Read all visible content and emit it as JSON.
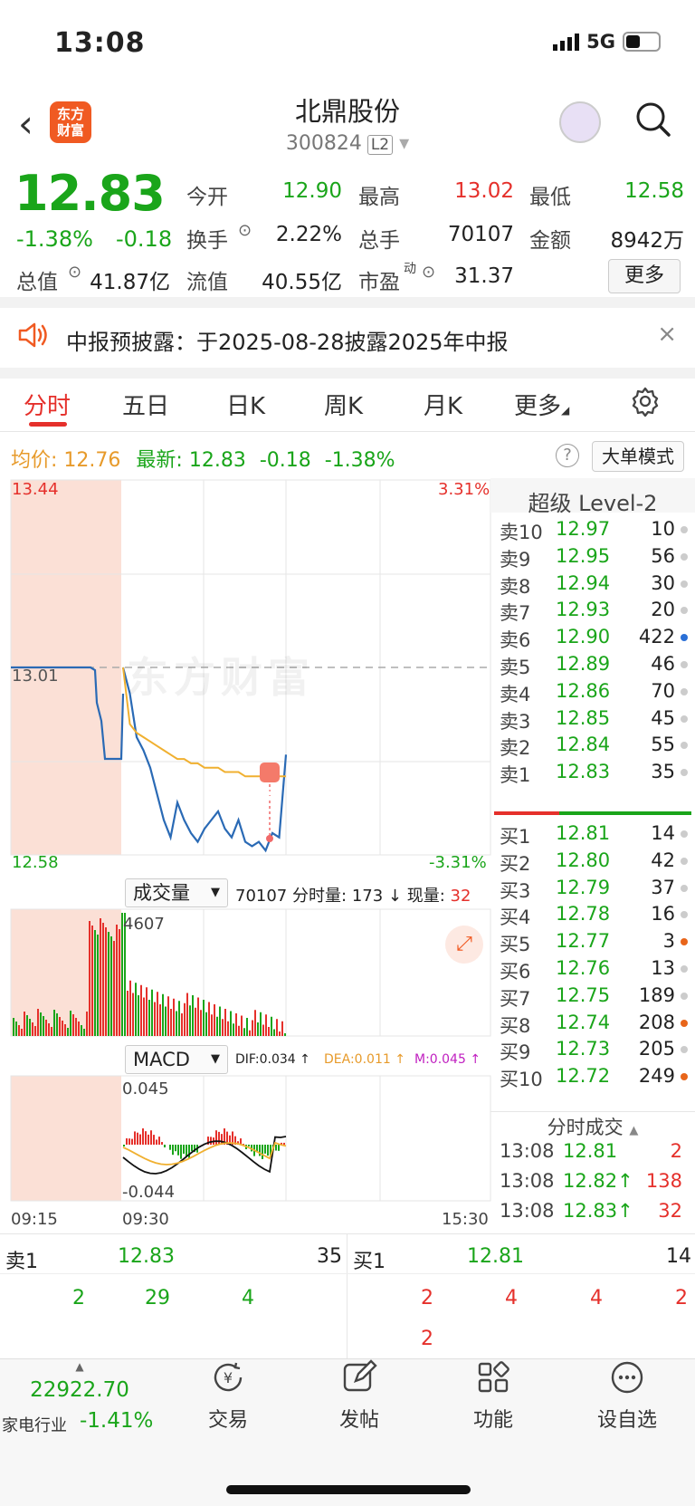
{
  "status": {
    "time": "13:08",
    "network": "5G"
  },
  "header": {
    "logo_text": "东方\n财富",
    "title": "北鼎股份",
    "code": "300824",
    "level": "L2"
  },
  "quote": {
    "price": "12.83",
    "change_pct": "-1.38%",
    "change": "-0.18",
    "fields": [
      {
        "label": "今开",
        "value": "12.90",
        "color": "green"
      },
      {
        "label": "最高",
        "value": "13.02",
        "color": "red"
      },
      {
        "label": "最低",
        "value": "12.58",
        "color": "green"
      },
      {
        "label": "换手",
        "value": "2.22%",
        "color": "dark"
      },
      {
        "label": "总手",
        "value": "70107",
        "color": "dark"
      },
      {
        "label": "金额",
        "value": "8942万",
        "color": "dark"
      },
      {
        "label": "总值",
        "value": "41.87亿",
        "color": "dark"
      },
      {
        "label": "流值",
        "value": "40.55亿",
        "color": "dark"
      },
      {
        "label": "市盈",
        "value": "31.37",
        "color": "dark"
      }
    ],
    "pe_sup": "动",
    "more": "更多"
  },
  "notice": {
    "text": "中报预披露：于2025-08-28披露2025年中报",
    "close": "×"
  },
  "tabs": [
    "分时",
    "五日",
    "日K",
    "周K",
    "月K",
    "更多"
  ],
  "info": {
    "avg_label": "均价:",
    "avg": "12.76",
    "last_label": "最新:",
    "last": "12.83",
    "chg": "-0.18",
    "pct": "-1.38%",
    "mode": "大单模式"
  },
  "chart": {
    "y_top": "13.44",
    "y_mid": "13.01",
    "y_bottom": "12.58",
    "pct_top": "3.31%",
    "pct_bottom": "-3.31%",
    "watermark": "东方财富",
    "vol_selector": "成交量",
    "vol_info_total": "70107",
    "vol_info_label": "分时量:",
    "vol_info_val": "173",
    "vol_info_now_label": "现量:",
    "vol_info_now": "32",
    "vol_max": "4607",
    "macd_selector": "MACD",
    "dif": "DIF:0.034 ↑",
    "dea": "DEA:0.011 ↑",
    "m": "M:0.045 ↑",
    "macd_top": "0.045",
    "macd_bottom": "-0.044",
    "t_start": "09:15",
    "t_open": "09:30",
    "t_end": "15:30",
    "marker": "B"
  },
  "chart_data": {
    "type": "line",
    "x": [
      "09:30",
      "09:35",
      "09:40",
      "09:45",
      "09:50",
      "09:55",
      "10:00",
      "10:05",
      "10:10",
      "10:15",
      "10:20",
      "10:25",
      "10:30",
      "10:35",
      "10:40",
      "10:45",
      "10:50",
      "10:55",
      "11:00",
      "11:05",
      "11:10",
      "11:15",
      "11:20",
      "11:25",
      "11:30"
    ],
    "series": [
      {
        "name": "最新",
        "values": [
          13.01,
          12.95,
          12.85,
          12.82,
          12.78,
          12.72,
          12.66,
          12.62,
          12.7,
          12.66,
          12.63,
          12.61,
          12.64,
          12.66,
          12.68,
          12.64,
          12.62,
          12.66,
          12.61,
          12.6,
          12.61,
          12.59,
          12.63,
          12.62,
          12.81
        ]
      },
      {
        "name": "均价",
        "values": [
          13.01,
          12.88,
          12.86,
          12.85,
          12.84,
          12.83,
          12.82,
          12.81,
          12.8,
          12.8,
          12.79,
          12.79,
          12.78,
          12.78,
          12.78,
          12.77,
          12.77,
          12.77,
          12.76,
          12.76,
          12.76,
          12.76,
          12.76,
          12.76,
          12.76
        ]
      }
    ],
    "ylim": [
      12.58,
      13.44
    ]
  },
  "orderbook": {
    "title": "超级 Level-2",
    "asks": [
      {
        "l": "卖10",
        "p": "12.97",
        "v": "10",
        "dot": "#cccccc"
      },
      {
        "l": "卖9",
        "p": "12.95",
        "v": "56",
        "dot": "#cccccc"
      },
      {
        "l": "卖8",
        "p": "12.94",
        "v": "30",
        "dot": "#cccccc"
      },
      {
        "l": "卖7",
        "p": "12.93",
        "v": "20",
        "dot": "#cccccc"
      },
      {
        "l": "卖6",
        "p": "12.90",
        "v": "422",
        "dot": "#2a6fd6"
      },
      {
        "l": "卖5",
        "p": "12.89",
        "v": "46",
        "dot": "#cccccc"
      },
      {
        "l": "卖4",
        "p": "12.86",
        "v": "70",
        "dot": "#cccccc"
      },
      {
        "l": "卖3",
        "p": "12.85",
        "v": "45",
        "dot": "#cccccc"
      },
      {
        "l": "卖2",
        "p": "12.84",
        "v": "55",
        "dot": "#cccccc"
      },
      {
        "l": "卖1",
        "p": "12.83",
        "v": "35",
        "dot": "#cccccc"
      }
    ],
    "bids": [
      {
        "l": "买1",
        "p": "12.81",
        "v": "14",
        "dot": "#cccccc"
      },
      {
        "l": "买2",
        "p": "12.80",
        "v": "42",
        "dot": "#cccccc"
      },
      {
        "l": "买3",
        "p": "12.79",
        "v": "37",
        "dot": "#cccccc"
      },
      {
        "l": "买4",
        "p": "12.78",
        "v": "16",
        "dot": "#cccccc"
      },
      {
        "l": "买5",
        "p": "12.77",
        "v": "3",
        "dot": "#e8651a"
      },
      {
        "l": "买6",
        "p": "12.76",
        "v": "13",
        "dot": "#cccccc"
      },
      {
        "l": "买7",
        "p": "12.75",
        "v": "189",
        "dot": "#cccccc"
      },
      {
        "l": "买8",
        "p": "12.74",
        "v": "208",
        "dot": "#e8651a"
      },
      {
        "l": "买9",
        "p": "12.73",
        "v": "205",
        "dot": "#cccccc"
      },
      {
        "l": "买10",
        "p": "12.72",
        "v": "249",
        "dot": "#e8651a"
      }
    ],
    "trades_title": "分时成交",
    "trades": [
      {
        "t": "13:08",
        "p": "12.81",
        "v": "2",
        "arrow": ""
      },
      {
        "t": "13:08",
        "p": "12.82↑",
        "v": "138",
        "arrow": ""
      },
      {
        "t": "13:08",
        "p": "12.83↑",
        "v": "32",
        "arrow": ""
      }
    ]
  },
  "queue": {
    "sell_label": "卖1",
    "sell_price": "12.83",
    "sell_vol": "35",
    "sell_items": [
      "2",
      "29",
      "4"
    ],
    "buy_label": "买1",
    "buy_price": "12.81",
    "buy_vol": "14",
    "buy_items": [
      "2",
      "4",
      "4",
      "2",
      "2"
    ]
  },
  "bottom": {
    "index_value": "22922.70",
    "index_name": "家电行业",
    "index_pct": "-1.41%",
    "nav": [
      {
        "label": "交易"
      },
      {
        "label": "发帖"
      },
      {
        "label": "功能"
      },
      {
        "label": "设自选"
      }
    ]
  }
}
